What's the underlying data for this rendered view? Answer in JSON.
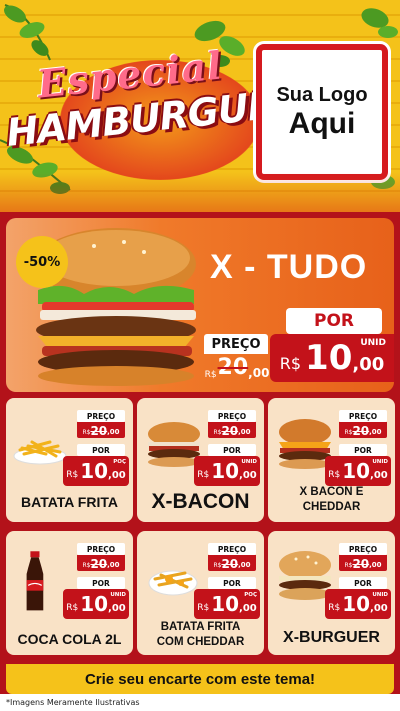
{
  "header": {
    "title_top": "Especial",
    "title_main": "HAMBURGUER",
    "logo_line1": "Sua Logo",
    "logo_line2": "Aqui"
  },
  "hero": {
    "discount": "-50%",
    "name": "X - TUDO",
    "por_label": "POR",
    "preco_label": "PREÇO",
    "old_currency": "R$",
    "old_value": "20",
    "old_cents": ",00",
    "new_currency": "R$",
    "new_value": "10",
    "new_cents": ",00",
    "unit": "UNID"
  },
  "cards": [
    {
      "name": "BATATA FRITA",
      "preco_label": "PREÇO",
      "old_currency": "R$",
      "old_value": "20",
      "old_cents": ",00",
      "por_label": "POR",
      "new_currency": "R$",
      "new_value": "10",
      "new_cents": ",00",
      "unit": "POÇ",
      "icon": "fries-icon"
    },
    {
      "name": "X-BACON",
      "preco_label": "PREÇO",
      "old_currency": "R$",
      "old_value": "20",
      "old_cents": ",00",
      "por_label": "POR",
      "new_currency": "R$",
      "new_value": "10",
      "new_cents": ",00",
      "unit": "UNID",
      "icon": "bacon-burger-icon"
    },
    {
      "name_line1": "X BACON E",
      "name_line2": "CHEDDAR",
      "preco_label": "PREÇO",
      "old_currency": "R$",
      "old_value": "20",
      "old_cents": ",00",
      "por_label": "POR",
      "new_currency": "R$",
      "new_value": "10",
      "new_cents": ",00",
      "unit": "UNID",
      "icon": "cheddar-burger-icon"
    },
    {
      "name": "COCA COLA 2L",
      "preco_label": "PREÇO",
      "old_currency": "R$",
      "old_value": "20",
      "old_cents": ",00",
      "por_label": "POR",
      "new_currency": "R$",
      "new_value": "10",
      "new_cents": ",00",
      "unit": "UNID",
      "icon": "soda-bottle-icon"
    },
    {
      "name_line1": "BATATA FRITA",
      "name_line2": "COM CHEDDAR",
      "preco_label": "PREÇO",
      "old_currency": "R$",
      "old_value": "20",
      "old_cents": ",00",
      "por_label": "POR",
      "new_currency": "R$",
      "new_value": "10",
      "new_cents": ",00",
      "unit": "POÇ",
      "icon": "cheddar-fries-icon"
    },
    {
      "name": "X-BURGUER",
      "preco_label": "PREÇO",
      "old_currency": "R$",
      "old_value": "20",
      "old_cents": ",00",
      "por_label": "POR",
      "new_currency": "R$",
      "new_value": "10",
      "new_cents": ",00",
      "unit": "UNID",
      "icon": "burger-icon"
    }
  ],
  "footer": {
    "cta": "Crie seu encarte com este tema!",
    "disclaimer": "*Imagens Meramente Ilustrativas"
  },
  "colors": {
    "red": "#c3121a",
    "yellow": "#f4c21a",
    "orange": "#f07a2a",
    "card_bg": "#f9e2c6"
  }
}
